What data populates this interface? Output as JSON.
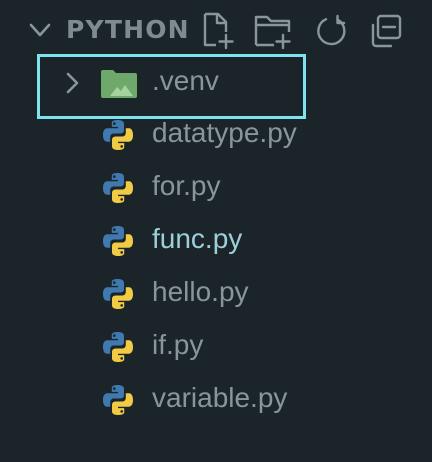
{
  "explorer": {
    "section_title": "PYTHON",
    "actions": [
      {
        "name": "new-file",
        "icon": "new-file-icon"
      },
      {
        "name": "new-folder",
        "icon": "new-folder-icon"
      },
      {
        "name": "refresh",
        "icon": "refresh-icon"
      },
      {
        "name": "collapse-all",
        "icon": "collapse-all-icon"
      }
    ],
    "folder": {
      "label": ".venv",
      "icon": "folder-icon",
      "expanded": false
    },
    "files": [
      {
        "label": "datatype.py",
        "icon": "python-icon"
      },
      {
        "label": "for.py",
        "icon": "python-icon"
      },
      {
        "label": "func.py",
        "icon": "python-icon",
        "active": true
      },
      {
        "label": "hello.py",
        "icon": "python-icon"
      },
      {
        "label": "if.py",
        "icon": "python-icon"
      },
      {
        "label": "variable.py",
        "icon": "python-icon"
      }
    ]
  },
  "colors": {
    "background": "#1b2529",
    "header_text": "#7f8b91",
    "file_text": "#8a959b",
    "active_file_text": "#9ccfd9",
    "focus_border": "#7fe3ef",
    "folder_green": "#6fa86b",
    "python_blue": "#3f79b0",
    "python_yellow": "#f2cb45"
  }
}
